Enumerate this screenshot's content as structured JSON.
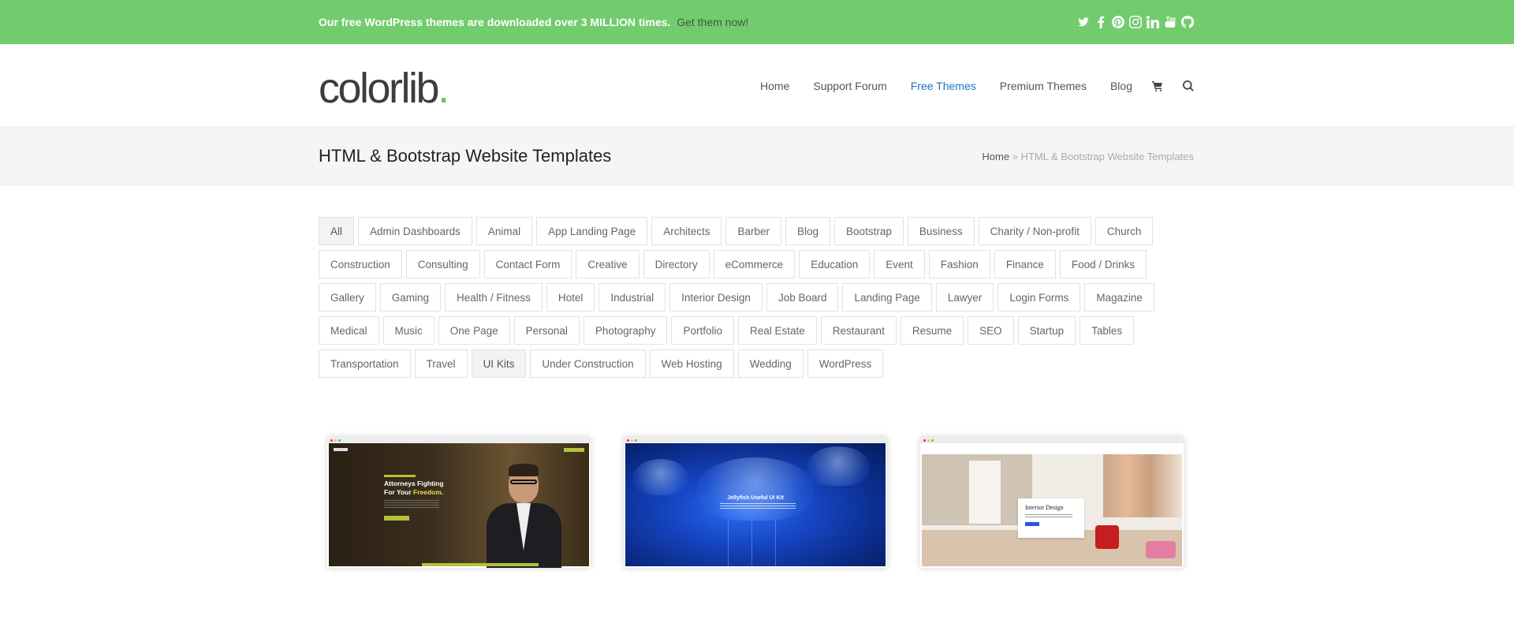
{
  "topbar": {
    "promo_text": "Our free WordPress themes are downloaded over 3 MILLION times.",
    "promo_link": "Get them now!",
    "social_icons": [
      "twitter-icon",
      "facebook-icon",
      "pinterest-icon",
      "instagram-icon",
      "linkedin-icon",
      "youtube-icon",
      "github-icon"
    ]
  },
  "header": {
    "logo_text": "colorlib",
    "logo_dot": ".",
    "nav": [
      {
        "label": "Home"
      },
      {
        "label": "Support Forum"
      },
      {
        "label": "Free Themes",
        "active": true
      },
      {
        "label": "Premium Themes"
      },
      {
        "label": "Blog"
      }
    ],
    "colors": {
      "accent": "#1e73be",
      "brand_green": "#72cc6d"
    }
  },
  "titlebar": {
    "title": "HTML & Bootstrap Website Templates",
    "breadcrumb_home": "Home",
    "breadcrumb_sep": "»",
    "breadcrumb_current": "HTML & Bootstrap Website Templates"
  },
  "filters": [
    "All",
    "Admin Dashboards",
    "Animal",
    "App Landing Page",
    "Architects",
    "Barber",
    "Blog",
    "Bootstrap",
    "Business",
    "Charity / Non-profit",
    "Church",
    "Construction",
    "Consulting",
    "Contact Form",
    "Creative",
    "Directory",
    "eCommerce",
    "Education",
    "Event",
    "Fashion",
    "Finance",
    "Food / Drinks",
    "Gallery",
    "Gaming",
    "Health / Fitness",
    "Hotel",
    "Industrial",
    "Interior Design",
    "Job Board",
    "Landing Page",
    "Lawyer",
    "Login Forms",
    "Magazine",
    "Medical",
    "Music",
    "One Page",
    "Personal",
    "Photography",
    "Portfolio",
    "Real Estate",
    "Restaurant",
    "Resume",
    "SEO",
    "Startup",
    "Tables",
    "Transportation",
    "Travel",
    "UI Kits",
    "Under Construction",
    "Web Hosting",
    "Wedding",
    "WordPress"
  ],
  "selected_filters": [
    "All",
    "UI Kits"
  ],
  "cards": [
    {
      "headline_1": "Attorneys Fighting",
      "headline_2a": "For Your ",
      "headline_2b": "Freedom."
    },
    {
      "title": "Jellyfish Useful UI Kit"
    },
    {
      "title": "Interior Design"
    }
  ]
}
